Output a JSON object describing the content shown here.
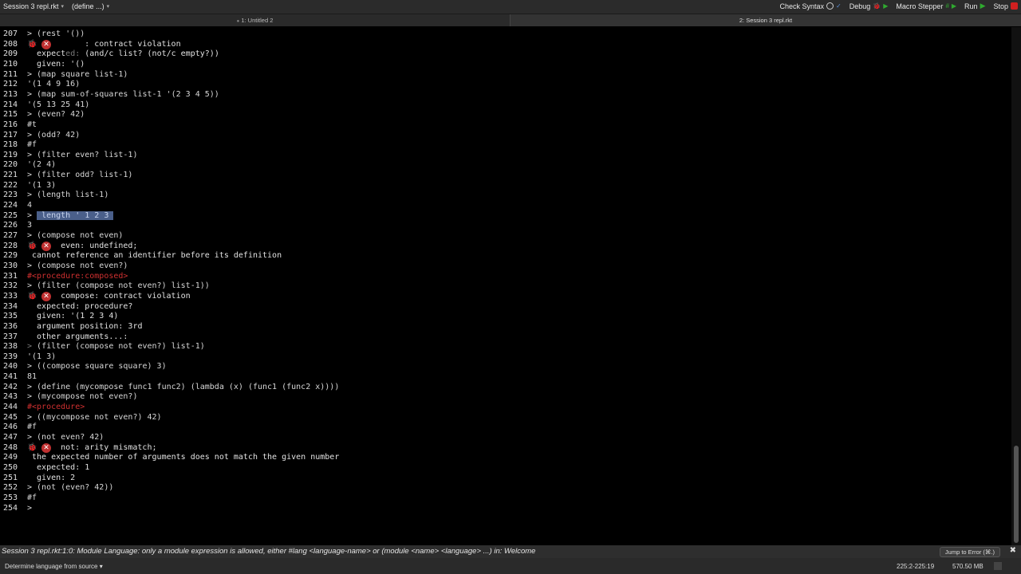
{
  "toolbar": {
    "left": [
      {
        "label": "Session 3 repl.rkt"
      },
      {
        "label": "(define ...)"
      }
    ],
    "check_syntax": "Check Syntax",
    "debug": "Debug",
    "macro_stepper": "Macro Stepper",
    "run": "Run",
    "stop": "Stop"
  },
  "tabs": [
    {
      "label": "1: Untitled 2"
    },
    {
      "label": "2: Session 3 repl.rkt"
    }
  ],
  "lines": [
    {
      "n": "207",
      "segs": [
        [
          "in",
          "> (rest '())"
        ]
      ]
    },
    {
      "n": "208",
      "error": true,
      "segs": [
        [
          "err",
          "     : contract violation"
        ]
      ]
    },
    {
      "n": "209",
      "segs": [
        [
          "err",
          "  expect"
        ],
        [
          "dim",
          "ed: "
        ],
        [
          "err",
          "(and/c list? (not/c empty?))"
        ]
      ]
    },
    {
      "n": "210",
      "segs": [
        [
          "err",
          "  given: '()"
        ]
      ]
    },
    {
      "n": "211",
      "segs": [
        [
          "in",
          "> (map square list-1)"
        ]
      ]
    },
    {
      "n": "212",
      "segs": [
        [
          "in",
          "'(1 4 9 16)"
        ]
      ]
    },
    {
      "n": "213",
      "segs": [
        [
          "in",
          "> (map sum-of-squares list-1 '(2 3 4 5))"
        ]
      ]
    },
    {
      "n": "214",
      "segs": [
        [
          "in",
          "'(5 13 25 41)"
        ]
      ]
    },
    {
      "n": "215",
      "segs": [
        [
          "in",
          "> (even? 42)"
        ]
      ]
    },
    {
      "n": "216",
      "segs": [
        [
          "in",
          "#t"
        ]
      ]
    },
    {
      "n": "217",
      "segs": [
        [
          "in",
          "> (odd? 42)"
        ]
      ]
    },
    {
      "n": "218",
      "segs": [
        [
          "in",
          "#f"
        ]
      ]
    },
    {
      "n": "219",
      "segs": [
        [
          "in",
          "> (filter even? list-1)"
        ]
      ]
    },
    {
      "n": "220",
      "segs": [
        [
          "in",
          "'(2 4)"
        ]
      ]
    },
    {
      "n": "221",
      "segs": [
        [
          "in",
          "> (filter odd? list-1)"
        ]
      ]
    },
    {
      "n": "222",
      "segs": [
        [
          "in",
          "'(1 3)"
        ]
      ]
    },
    {
      "n": "223",
      "segs": [
        [
          "in",
          "> (length list-1)"
        ]
      ]
    },
    {
      "n": "224",
      "segs": [
        [
          "in",
          "4"
        ]
      ]
    },
    {
      "n": "225",
      "segs": [
        [
          "in",
          "> "
        ],
        [
          "sel",
          " length ' 1 2 3 "
        ]
      ]
    },
    {
      "n": "226",
      "segs": [
        [
          "in",
          "3"
        ]
      ]
    },
    {
      "n": "227",
      "segs": [
        [
          "in",
          "> (compose not even)"
        ]
      ]
    },
    {
      "n": "228",
      "error": true,
      "segs": [
        [
          "err",
          "even: undefined;"
        ]
      ]
    },
    {
      "n": "229",
      "segs": [
        [
          "err",
          " cannot reference an identifier before its definition"
        ]
      ]
    },
    {
      "n": "230",
      "segs": [
        [
          "in",
          "> (compose not even?)"
        ]
      ]
    },
    {
      "n": "231",
      "segs": [
        [
          "red",
          "#<procedure:composed>"
        ]
      ]
    },
    {
      "n": "232",
      "segs": [
        [
          "in",
          "> (filter (compose not even?) list-1))"
        ]
      ]
    },
    {
      "n": "233",
      "error": true,
      "segs": [
        [
          "err",
          "compose: contract violation"
        ]
      ]
    },
    {
      "n": "234",
      "segs": [
        [
          "err",
          "  expected: procedure?"
        ]
      ]
    },
    {
      "n": "235",
      "segs": [
        [
          "err",
          "  given: '(1 2 3 4)"
        ]
      ]
    },
    {
      "n": "236",
      "segs": [
        [
          "err",
          "  argument position: 3rd"
        ]
      ]
    },
    {
      "n": "237",
      "segs": [
        [
          "err",
          "  other arguments...:"
        ]
      ]
    },
    {
      "n": "238",
      "segs": [
        [
          "dim",
          "> "
        ],
        [
          "in",
          "(filter (compose not even?) list-1)"
        ]
      ]
    },
    {
      "n": "239",
      "segs": [
        [
          "in",
          "'(1 3)"
        ]
      ]
    },
    {
      "n": "240",
      "segs": [
        [
          "in",
          "> ((compose square square) 3)"
        ]
      ]
    },
    {
      "n": "241",
      "segs": [
        [
          "in",
          "81"
        ]
      ]
    },
    {
      "n": "242",
      "segs": [
        [
          "in",
          "> (define (mycompose func1 func2) (lambda (x) (func1 (func2 x))))"
        ]
      ]
    },
    {
      "n": "243",
      "segs": [
        [
          "in",
          "> (mycompose not even?)"
        ]
      ]
    },
    {
      "n": "244",
      "segs": [
        [
          "red",
          "#<procedure>"
        ]
      ]
    },
    {
      "n": "245",
      "segs": [
        [
          "in",
          "> ((mycompose not even?) 42)"
        ]
      ]
    },
    {
      "n": "246",
      "segs": [
        [
          "in",
          "#f"
        ]
      ]
    },
    {
      "n": "247",
      "segs": [
        [
          "in",
          "> (not even? 42)"
        ]
      ]
    },
    {
      "n": "248",
      "error": true,
      "segs": [
        [
          "err",
          "not: arity mismatch;"
        ]
      ]
    },
    {
      "n": "249",
      "segs": [
        [
          "err",
          " the expected number of arguments does not match the given number"
        ]
      ]
    },
    {
      "n": "250",
      "segs": [
        [
          "err",
          "  expected: 1"
        ]
      ]
    },
    {
      "n": "251",
      "segs": [
        [
          "err",
          "  given: 2"
        ]
      ]
    },
    {
      "n": "252",
      "segs": [
        [
          "in",
          "> (not (even? 42))"
        ]
      ]
    },
    {
      "n": "253",
      "segs": [
        [
          "in",
          "#f"
        ]
      ]
    },
    {
      "n": "254",
      "segs": [
        [
          "in",
          "> "
        ]
      ]
    }
  ],
  "status": {
    "message": "Session 3 repl.rkt:1:0: Module Language: only a module expression is allowed, either #lang <language-name> or (module <name> <language> ...)  in: Welcome",
    "jump_button": "Jump to Error (⌘.)"
  },
  "bottom": {
    "language": "Determine language from source",
    "position": "225:2-225:19",
    "memory": "570.50 MB"
  },
  "colors": {
    "error_red": "#c03030",
    "run_green": "#2faa2f",
    "stop_red": "#d02020",
    "selection": "#4a5f8a"
  }
}
